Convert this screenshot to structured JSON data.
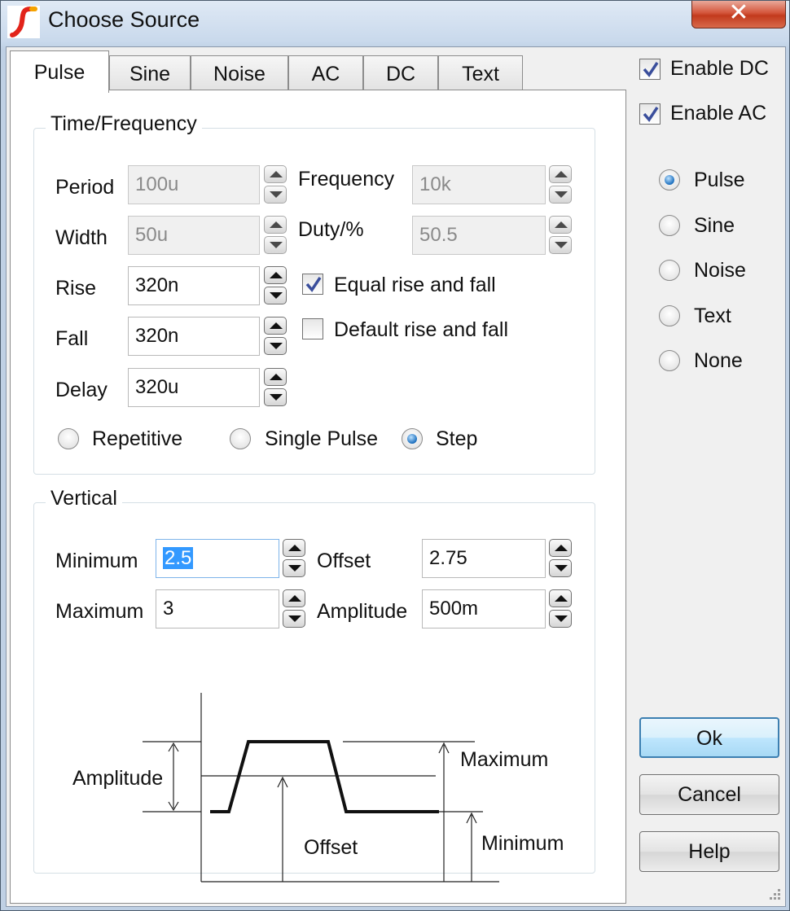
{
  "window": {
    "title": "Choose Source",
    "close_glyph": "✕"
  },
  "tabs": [
    "Pulse",
    "Sine",
    "Noise",
    "AC",
    "DC",
    "Text"
  ],
  "time_frequency": {
    "title": "Time/Frequency",
    "period": {
      "label": "Period",
      "value": "100u"
    },
    "frequency": {
      "label": "Frequency",
      "value": "10k"
    },
    "width": {
      "label": "Width",
      "value": "50u"
    },
    "duty": {
      "label": "Duty/%",
      "value": "50.5"
    },
    "rise": {
      "label": "Rise",
      "value": "320n"
    },
    "fall": {
      "label": "Fall",
      "value": "320n"
    },
    "delay": {
      "label": "Delay",
      "value": "320u"
    },
    "equal_rise_fall": {
      "label": "Equal rise and fall",
      "checked": true
    },
    "default_rise_fall": {
      "label": "Default rise and fall",
      "checked": false
    },
    "mode": {
      "options": [
        "Repetitive",
        "Single Pulse",
        "Step"
      ],
      "selected": "Step"
    }
  },
  "vertical": {
    "title": "Vertical",
    "minimum": {
      "label": "Minimum",
      "value": "2.5"
    },
    "offset": {
      "label": "Offset",
      "value": "2.75"
    },
    "maximum": {
      "label": "Maximum",
      "value": "3"
    },
    "amplitude": {
      "label": "Amplitude",
      "value": "500m"
    }
  },
  "diagram": {
    "amplitude": "Amplitude",
    "offset": "Offset",
    "maximum": "Maximum",
    "minimum": "Minimum"
  },
  "enable": {
    "dc": {
      "label": "Enable DC",
      "checked": true
    },
    "ac": {
      "label": "Enable AC",
      "checked": true
    }
  },
  "source_type": {
    "options": [
      "Pulse",
      "Sine",
      "Noise",
      "Text",
      "None"
    ],
    "selected": "Pulse"
  },
  "buttons": {
    "ok": "Ok",
    "cancel": "Cancel",
    "help": "Help"
  },
  "colors": {
    "accent": "#3399ff",
    "radio_dot": "#1b6fbf",
    "check": "#3a4e9c"
  }
}
